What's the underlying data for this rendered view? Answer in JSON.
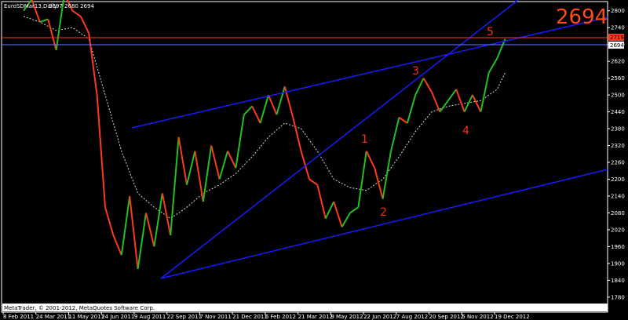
{
  "header": {
    "symbol": "EuroSDMar13,Daily",
    "ohlc": "2697 2680 2694"
  },
  "big_price_label": "2694",
  "copyright": "MetaTrader, © 2001-2012, MetaQuotes Software Corp.",
  "price_tags": {
    "resistance": "2719",
    "current": "2694"
  },
  "wave_labels": [
    "1",
    "2",
    "3",
    "4",
    "5"
  ],
  "colors": {
    "background": "#000000",
    "bull_candle": "#22c022",
    "bear_candle": "#ff3a1a",
    "trendlines": "#1a1aff",
    "resistance_line": "#ff3a1a",
    "current_line": "#6a7cff",
    "wave_labels": "#ff2a10",
    "moving_average": "#d8d8d8"
  },
  "chart_data": {
    "type": "line",
    "title": "EuroSDMar13,Daily",
    "y_ticks": [
      1780,
      1840,
      1900,
      1960,
      2020,
      2080,
      2140,
      2200,
      2260,
      2320,
      2380,
      2440,
      2500,
      2560,
      2620,
      2680,
      2740,
      2800
    ],
    "ylim": [
      1760,
      2830
    ],
    "x_ticks": [
      "8 Feb 2011",
      "24 Mar 2011",
      "11 May 2011",
      "24 Jun 2011",
      "9 Aug 2011",
      "22 Sep 2011",
      "7 Nov 2011",
      "21 Dec 2011",
      "6 Feb 2012",
      "21 Mar 2012",
      "9 May 2012",
      "22 Jun 2012",
      "7 Aug 2012",
      "20 Sep 2012",
      "5 Nov 2012",
      "19 Dec 2012"
    ],
    "price_path": [
      [
        0,
        2800
      ],
      [
        1,
        2840
      ],
      [
        2,
        2760
      ],
      [
        3,
        2770
      ],
      [
        4,
        2660
      ],
      [
        5,
        2860
      ],
      [
        6,
        2800
      ],
      [
        7,
        2780
      ],
      [
        8,
        2720
      ],
      [
        9,
        2500
      ],
      [
        10,
        2100
      ],
      [
        11,
        2000
      ],
      [
        12,
        1930
      ],
      [
        13,
        2140
      ],
      [
        14,
        1880
      ],
      [
        15,
        2080
      ],
      [
        16,
        1960
      ],
      [
        17,
        2150
      ],
      [
        18,
        2000
      ],
      [
        19,
        2350
      ],
      [
        20,
        2180
      ],
      [
        21,
        2300
      ],
      [
        22,
        2120
      ],
      [
        23,
        2320
      ],
      [
        24,
        2200
      ],
      [
        25,
        2300
      ],
      [
        26,
        2240
      ],
      [
        27,
        2430
      ],
      [
        28,
        2460
      ],
      [
        29,
        2400
      ],
      [
        30,
        2500
      ],
      [
        31,
        2430
      ],
      [
        32,
        2530
      ],
      [
        33,
        2420
      ],
      [
        34,
        2300
      ],
      [
        35,
        2200
      ],
      [
        36,
        2180
      ],
      [
        37,
        2060
      ],
      [
        38,
        2120
      ],
      [
        39,
        2030
      ],
      [
        40,
        2080
      ],
      [
        41,
        2100
      ],
      [
        42,
        2300
      ],
      [
        43,
        2240
      ],
      [
        44,
        2130
      ],
      [
        45,
        2300
      ],
      [
        46,
        2420
      ],
      [
        47,
        2400
      ],
      [
        48,
        2500
      ],
      [
        49,
        2560
      ],
      [
        50,
        2510
      ],
      [
        51,
        2440
      ],
      [
        52,
        2480
      ],
      [
        53,
        2520
      ],
      [
        54,
        2440
      ],
      [
        55,
        2500
      ],
      [
        56,
        2440
      ],
      [
        57,
        2580
      ],
      [
        58,
        2630
      ],
      [
        59,
        2700
      ]
    ],
    "moving_average": [
      [
        0,
        2780
      ],
      [
        2,
        2760
      ],
      [
        4,
        2730
      ],
      [
        6,
        2740
      ],
      [
        8,
        2700
      ],
      [
        10,
        2500
      ],
      [
        12,
        2300
      ],
      [
        14,
        2150
      ],
      [
        16,
        2100
      ],
      [
        18,
        2060
      ],
      [
        20,
        2100
      ],
      [
        22,
        2150
      ],
      [
        24,
        2180
      ],
      [
        26,
        2220
      ],
      [
        28,
        2280
      ],
      [
        30,
        2350
      ],
      [
        32,
        2400
      ],
      [
        34,
        2380
      ],
      [
        36,
        2300
      ],
      [
        38,
        2200
      ],
      [
        40,
        2170
      ],
      [
        42,
        2160
      ],
      [
        44,
        2200
      ],
      [
        46,
        2280
      ],
      [
        48,
        2370
      ],
      [
        50,
        2440
      ],
      [
        52,
        2460
      ],
      [
        54,
        2470
      ],
      [
        56,
        2480
      ],
      [
        58,
        2520
      ],
      [
        59,
        2580
      ]
    ],
    "trendlines": [
      {
        "from": [
          "9 Aug 2011",
          1850
        ],
        "to": [
          "19 Dec 2012",
          2720
        ]
      },
      {
        "from": [
          "9 Aug 2011",
          1850
        ],
        "to": [
          "19 Dec 2012",
          2250
        ]
      },
      {
        "from": [
          "22 Sep 2011",
          2400
        ],
        "to": [
          "19 Dec 2012",
          2780
        ]
      }
    ],
    "resistance": 2719,
    "current_price": 2694,
    "grid": false
  }
}
